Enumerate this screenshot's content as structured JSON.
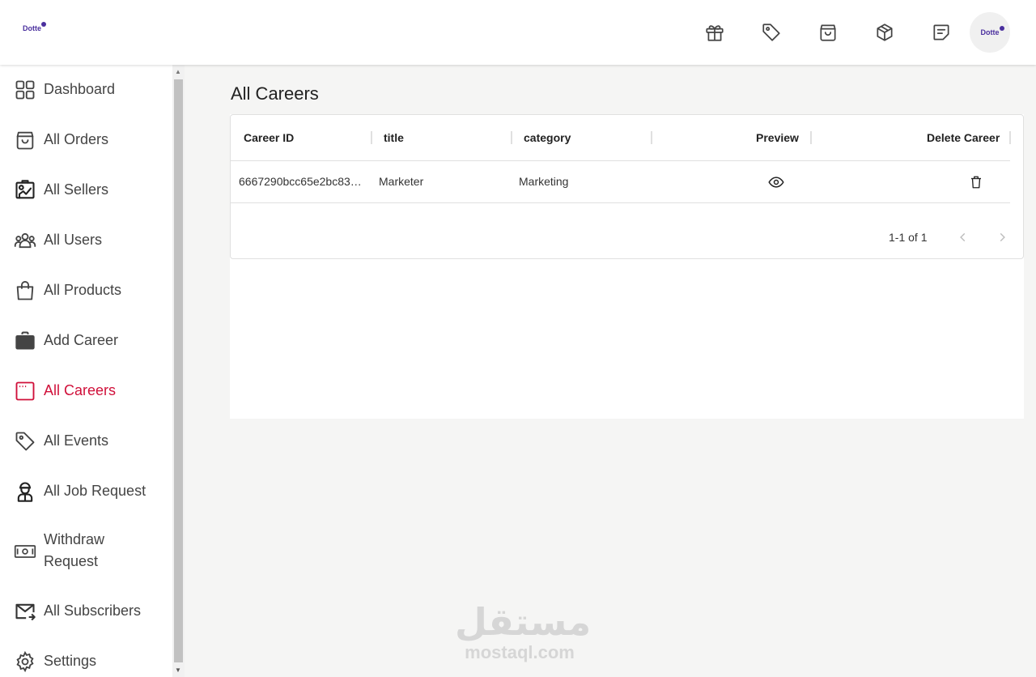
{
  "header": {
    "logo_text": "Dotte",
    "icons": [
      "gift-icon",
      "tag-icon",
      "shopping-bag-icon",
      "package-icon",
      "note-icon"
    ],
    "avatar_text": "Dotte"
  },
  "sidebar": {
    "items": [
      {
        "label": "Dashboard",
        "icon": "dashboard-icon"
      },
      {
        "label": "All Orders",
        "icon": "shopping-bag-icon"
      },
      {
        "label": "All Sellers",
        "icon": "seller-icon"
      },
      {
        "label": "All Users",
        "icon": "users-icon"
      },
      {
        "label": "All Products",
        "icon": "handbag-icon"
      },
      {
        "label": "Add Career",
        "icon": "briefcase-icon"
      },
      {
        "label": "All Careers",
        "icon": "window-icon",
        "active": true
      },
      {
        "label": "All Events",
        "icon": "tag-icon"
      },
      {
        "label": "All Job Request",
        "icon": "worker-icon"
      },
      {
        "label": "Withdraw Request",
        "icon": "cash-icon"
      },
      {
        "label": "All Subscribers",
        "icon": "mail-icon"
      },
      {
        "label": "Settings",
        "icon": "gear-icon"
      }
    ],
    "active_color": "#d0103a"
  },
  "main": {
    "title": "All Careers",
    "table": {
      "columns": [
        "Career ID",
        "title",
        "category",
        "Preview",
        "Delete Career"
      ],
      "rows": [
        {
          "id": "6667290bcc65e2bc83…",
          "title": "Marketer",
          "category": "Marketing"
        }
      ],
      "pagination": "1-1 of 1"
    }
  },
  "watermark": {
    "arabic": "مستقل",
    "latin": "mostaql.com"
  }
}
